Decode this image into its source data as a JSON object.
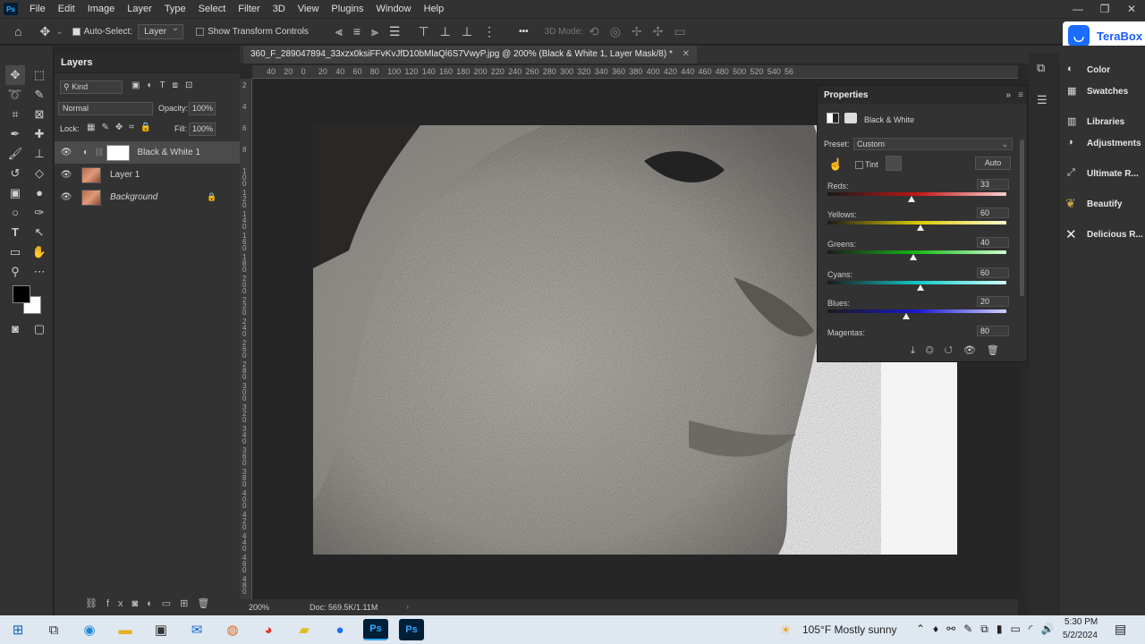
{
  "menu": {
    "app_icon": "Ps",
    "items": [
      "File",
      "Edit",
      "Image",
      "Layer",
      "Type",
      "Select",
      "Filter",
      "3D",
      "View",
      "Plugins",
      "Window",
      "Help"
    ],
    "window_controls": [
      "—",
      "❐",
      "✕"
    ]
  },
  "options_bar": {
    "auto_select_label": "Auto-Select:",
    "auto_select_value": "Layer",
    "transform_label": "Show Transform Controls",
    "mode_label": "3D Mode:",
    "more": "•••"
  },
  "terabox": {
    "label": "TeraBox"
  },
  "doc": {
    "tab_title": "360_F_289047894_33xzx0ksiFFvKvJfD10bMlaQl6S7VwyP.jpg @ 200% (Black & White 1, Layer Mask/8) *",
    "ruler_ticks": [
      "40",
      "20",
      "0",
      "20",
      "40",
      "60",
      "80",
      "100",
      "120",
      "140",
      "160",
      "180",
      "200",
      "220",
      "240",
      "260",
      "280",
      "300",
      "320",
      "340",
      "360",
      "380",
      "400",
      "420",
      "440",
      "460",
      "480",
      "500",
      "520",
      "540",
      "56"
    ],
    "vruler_ticks": [
      "2",
      "4",
      "6",
      "8",
      "1 0 0",
      "1 2 0",
      "1 4 0",
      "1 6 0",
      "1 8 0",
      "2 0 0",
      "2 2 0",
      "2 4 0",
      "2 6 0",
      "2 8 0",
      "3 0 0",
      "3 2 0",
      "3 4 0",
      "3 6 0",
      "3 8 0",
      "4 0 0",
      "4 2 0",
      "4 4 0",
      "4 6 0",
      "4 8 0"
    ],
    "zoom": "200%",
    "doc_size": "Doc: 569.5K/1.11M"
  },
  "layers": {
    "title": "Layers",
    "kind": "Kind",
    "blend": "Normal",
    "opacity_label": "Opacity:",
    "opacity_value": "100%",
    "lock_label": "Lock:",
    "fill_label": "Fill:",
    "fill_value": "100%",
    "items": [
      {
        "name": "Black & White 1"
      },
      {
        "name": "Layer 1"
      },
      {
        "name": "Background"
      }
    ]
  },
  "properties": {
    "title": "Properties",
    "adj_name": "Black & White",
    "preset_label": "Preset:",
    "preset_value": "Custom",
    "tint_label": "Tint",
    "auto_label": "Auto",
    "sliders": [
      {
        "label": "Reds:",
        "value": "33",
        "pct": 0.47,
        "grad": "linear-gradient(90deg,#1a1a1a,#c01616,#ffd0d0)"
      },
      {
        "label": "Yellows:",
        "value": "60",
        "pct": 0.52,
        "grad": "linear-gradient(90deg,#1a1a1a,#d8c800,#fffbd0)"
      },
      {
        "label": "Greens:",
        "value": "40",
        "pct": 0.48,
        "grad": "linear-gradient(90deg,#1a1a1a,#18b818,#d0ffd0)"
      },
      {
        "label": "Cyans:",
        "value": "60",
        "pct": 0.52,
        "grad": "linear-gradient(90deg,#1a1a1a,#10c8c8,#d0ffff)"
      },
      {
        "label": "Blues:",
        "value": "20",
        "pct": 0.44,
        "grad": "linear-gradient(90deg,#1a1a1a,#1818d0,#d0d0ff)"
      },
      {
        "label": "Magentas:",
        "value": "80"
      }
    ]
  },
  "right_panels": [
    "Color",
    "Swatches",
    "Libraries",
    "Adjustments",
    "Ultimate R...",
    "Beautify",
    "Delicious R..."
  ],
  "taskbar": {
    "weather": "105°F  Mostly sunny",
    "time": "5:30 PM",
    "date": "5/2/2024"
  }
}
